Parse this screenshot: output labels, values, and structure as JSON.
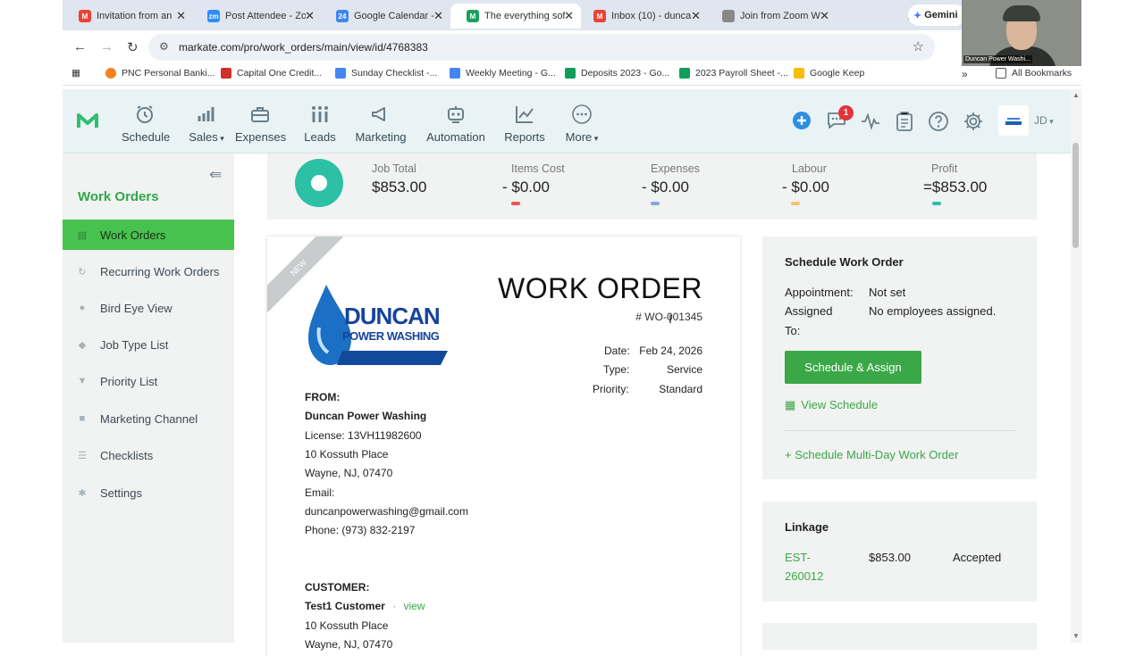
{
  "browser": {
    "tabs": [
      {
        "label": "Invitation from an",
        "icon_color": "#ea4335",
        "icon": "M",
        "active": false
      },
      {
        "label": "Post Attendee - Zo",
        "icon_color": "#2d8cff",
        "icon": "zm",
        "active": false
      },
      {
        "label": "Google Calendar -",
        "icon_color": "#4285f4",
        "icon": "24",
        "active": false
      },
      {
        "label": "The everything soft",
        "icon_color": "#1aa05b",
        "icon": "M",
        "active": true
      },
      {
        "label": "Inbox (10) - dunca",
        "icon_color": "#ea4335",
        "icon": "M",
        "active": false
      },
      {
        "label": "Join from Zoom W",
        "icon_color": "#666666",
        "icon": "",
        "active": false
      }
    ],
    "gemini_label": "Gemini",
    "url": "markate.com/pro/work_orders/main/view/id/4768383",
    "bookmarks": [
      {
        "label": "PNC Personal Banki...",
        "color": "#f58220"
      },
      {
        "label": "Capital One Credit...",
        "color": "#d03027"
      },
      {
        "label": "Sunday Checklist -...",
        "color": "#4285f4"
      },
      {
        "label": "Weekly Meeting - G...",
        "color": "#4285f4"
      },
      {
        "label": "Deposits 2023 - Go...",
        "color": "#0f9d58"
      },
      {
        "label": "2023 Payroll Sheet -...",
        "color": "#0f9d58"
      },
      {
        "label": "Google Keep",
        "color": "#fbbc04"
      }
    ],
    "all_bookmarks": "All Bookmarks"
  },
  "webcam": {
    "caption": "Duncan Power Washi..."
  },
  "nav": {
    "items": [
      {
        "label": "Schedule",
        "icon": "alarm-clock-icon"
      },
      {
        "label": "Sales",
        "icon": "bar-chart-icon",
        "dropdown": true
      },
      {
        "label": "Expenses",
        "icon": "briefcase-icon"
      },
      {
        "label": "Leads",
        "icon": "people-icon"
      },
      {
        "label": "Marketing",
        "icon": "megaphone-icon"
      },
      {
        "label": "Automation",
        "icon": "robot-icon"
      },
      {
        "label": "Reports",
        "icon": "line-chart-icon"
      },
      {
        "label": "More",
        "icon": "ellipsis-icon",
        "dropdown": true
      }
    ],
    "notification_count": "1",
    "user_initials": "JD"
  },
  "sidebar": {
    "title": "Work Orders",
    "items": [
      {
        "label": "Work Orders",
        "icon": "document-icon",
        "active": true
      },
      {
        "label": "Recurring Work Orders",
        "icon": "refresh-icon"
      },
      {
        "label": "Bird Eye View",
        "icon": "map-pin-icon"
      },
      {
        "label": "Job Type List",
        "icon": "tag-icon"
      },
      {
        "label": "Priority List",
        "icon": "pin-icon"
      },
      {
        "label": "Marketing Channel",
        "icon": "cube-icon"
      },
      {
        "label": "Checklists",
        "icon": "list-icon"
      },
      {
        "label": "Settings",
        "icon": "gear-icon"
      }
    ]
  },
  "summary": {
    "job_total_label": "Job Total",
    "job_total": "$853.00",
    "items_cost_label": "Items Cost",
    "items_cost": "- $0.00",
    "items_color": "#e8584a",
    "expenses_label": "Expenses",
    "expenses": "- $0.00",
    "expenses_color": "#86a8e0",
    "labour_label": "Labour",
    "labour": "- $0.00",
    "labour_color": "#f2c56b",
    "profit_label": "Profit",
    "profit": "=$853.00",
    "profit_color": "#2cc0a5"
  },
  "work_order": {
    "ribbon": "NEW",
    "title": "WORK ORDER",
    "number": "# WO-001345",
    "logo_line1": "DUNCAN",
    "logo_line2": "POWER WASHING",
    "date_label": "Date:",
    "date": "Feb 24, 2026",
    "type_label": "Type:",
    "type": "Service",
    "priority_label": "Priority:",
    "priority": "Standard",
    "from_label": "FROM:",
    "from_name": "Duncan Power Washing",
    "license": "License: 13VH11982600",
    "address1": "10 Kossuth Place",
    "address2": "Wayne, NJ, 07470",
    "email_label": "Email:",
    "email": "duncanpowerwashing@gmail.com",
    "phone": "Phone: (973) 832-2197",
    "customer_label": "CUSTOMER:",
    "customer_name": "Test1 Customer",
    "customer_sep": "·",
    "customer_view": "view",
    "customer_address1": "10 Kossuth Place",
    "customer_address2": "Wayne, NJ, 07470"
  },
  "schedule": {
    "title": "Schedule Work Order",
    "appointment_label": "Appointment:",
    "appointment": "Not set",
    "assigned_label_1": "Assigned",
    "assigned_label_2": "To:",
    "assigned": "No employees assigned.",
    "button": "Schedule & Assign",
    "view_schedule": "View Schedule",
    "multi_day": "+ Schedule Multi-Day Work Order"
  },
  "linkage": {
    "title": "Linkage",
    "ref_1": "EST-",
    "ref_2": "260012",
    "amount": "$853.00",
    "status": "Accepted"
  }
}
